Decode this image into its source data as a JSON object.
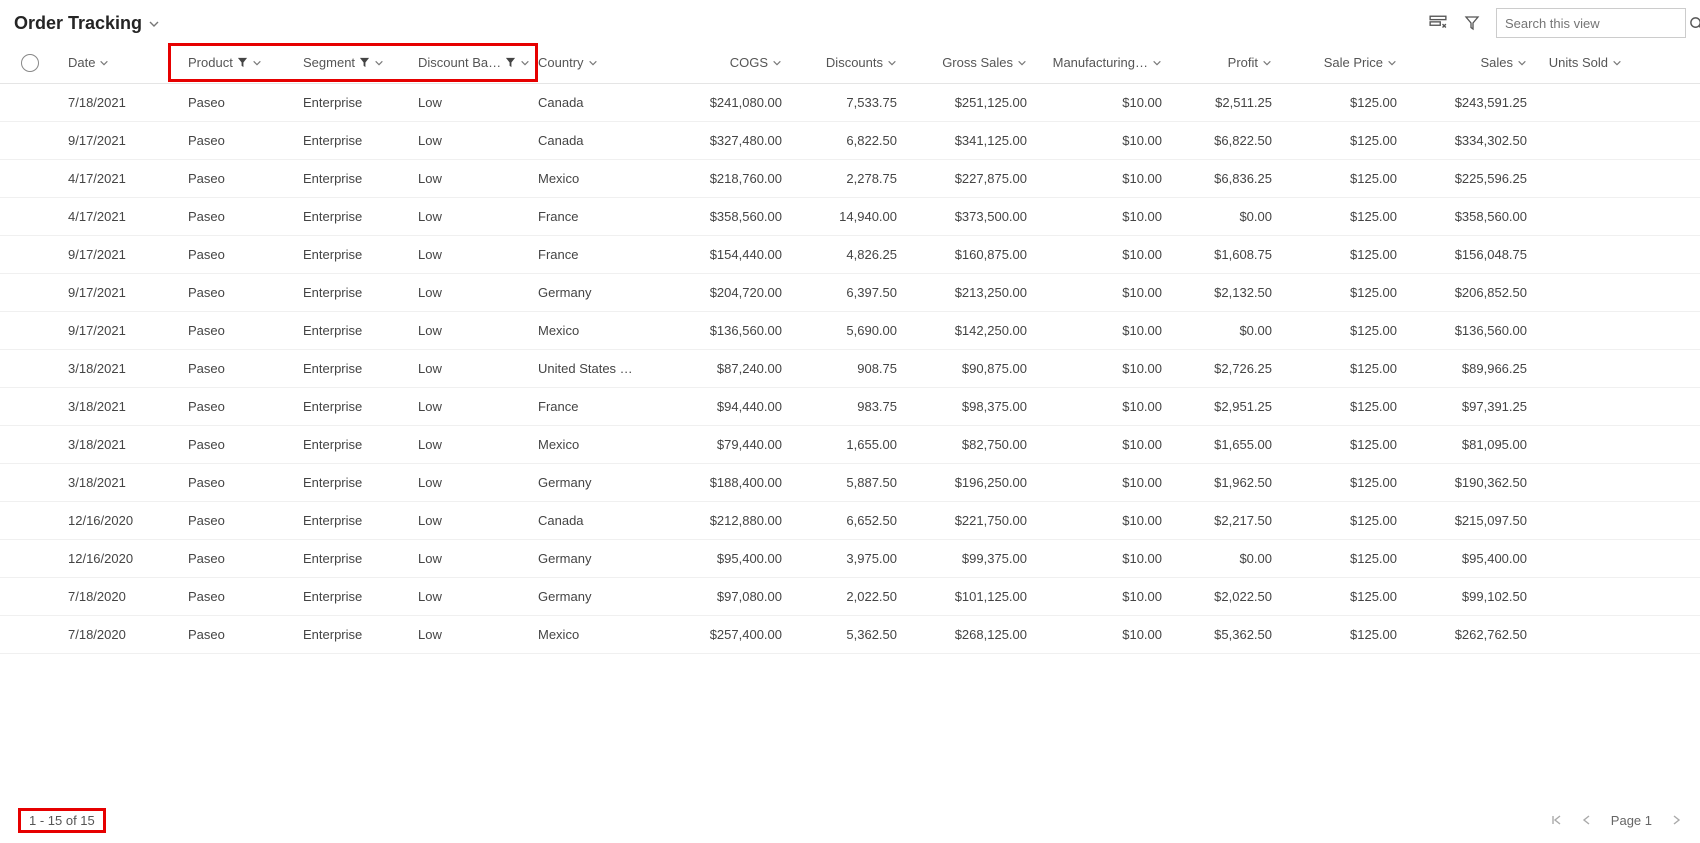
{
  "view": {
    "title": "Order Tracking"
  },
  "toolbar": {
    "search_placeholder": "Search this view"
  },
  "columns": {
    "date": "Date",
    "product": "Product",
    "segment": "Segment",
    "discount_band": "Discount Ba…",
    "country": "Country",
    "cogs": "COGS",
    "discounts": "Discounts",
    "gross_sales": "Gross Sales",
    "manufacturing": "Manufacturing…",
    "profit": "Profit",
    "sale_price": "Sale Price",
    "sales": "Sales",
    "units_sold": "Units Sold"
  },
  "rows": [
    {
      "date": "7/18/2021",
      "product": "Paseo",
      "segment": "Enterprise",
      "discount_band": "Low",
      "country": "Canada",
      "cogs": "$241,080.00",
      "discounts": "7,533.75",
      "gross_sales": "$251,125.00",
      "manufacturing": "$10.00",
      "profit": "$2,511.25",
      "sale_price": "$125.00",
      "sales": "$243,591.25"
    },
    {
      "date": "9/17/2021",
      "product": "Paseo",
      "segment": "Enterprise",
      "discount_band": "Low",
      "country": "Canada",
      "cogs": "$327,480.00",
      "discounts": "6,822.50",
      "gross_sales": "$341,125.00",
      "manufacturing": "$10.00",
      "profit": "$6,822.50",
      "sale_price": "$125.00",
      "sales": "$334,302.50"
    },
    {
      "date": "4/17/2021",
      "product": "Paseo",
      "segment": "Enterprise",
      "discount_band": "Low",
      "country": "Mexico",
      "cogs": "$218,760.00",
      "discounts": "2,278.75",
      "gross_sales": "$227,875.00",
      "manufacturing": "$10.00",
      "profit": "$6,836.25",
      "sale_price": "$125.00",
      "sales": "$225,596.25"
    },
    {
      "date": "4/17/2021",
      "product": "Paseo",
      "segment": "Enterprise",
      "discount_band": "Low",
      "country": "France",
      "cogs": "$358,560.00",
      "discounts": "14,940.00",
      "gross_sales": "$373,500.00",
      "manufacturing": "$10.00",
      "profit": "$0.00",
      "sale_price": "$125.00",
      "sales": "$358,560.00"
    },
    {
      "date": "9/17/2021",
      "product": "Paseo",
      "segment": "Enterprise",
      "discount_band": "Low",
      "country": "France",
      "cogs": "$154,440.00",
      "discounts": "4,826.25",
      "gross_sales": "$160,875.00",
      "manufacturing": "$10.00",
      "profit": "$1,608.75",
      "sale_price": "$125.00",
      "sales": "$156,048.75"
    },
    {
      "date": "9/17/2021",
      "product": "Paseo",
      "segment": "Enterprise",
      "discount_band": "Low",
      "country": "Germany",
      "cogs": "$204,720.00",
      "discounts": "6,397.50",
      "gross_sales": "$213,250.00",
      "manufacturing": "$10.00",
      "profit": "$2,132.50",
      "sale_price": "$125.00",
      "sales": "$206,852.50"
    },
    {
      "date": "9/17/2021",
      "product": "Paseo",
      "segment": "Enterprise",
      "discount_band": "Low",
      "country": "Mexico",
      "cogs": "$136,560.00",
      "discounts": "5,690.00",
      "gross_sales": "$142,250.00",
      "manufacturing": "$10.00",
      "profit": "$0.00",
      "sale_price": "$125.00",
      "sales": "$136,560.00"
    },
    {
      "date": "3/18/2021",
      "product": "Paseo",
      "segment": "Enterprise",
      "discount_band": "Low",
      "country": "United States …",
      "cogs": "$87,240.00",
      "discounts": "908.75",
      "gross_sales": "$90,875.00",
      "manufacturing": "$10.00",
      "profit": "$2,726.25",
      "sale_price": "$125.00",
      "sales": "$89,966.25"
    },
    {
      "date": "3/18/2021",
      "product": "Paseo",
      "segment": "Enterprise",
      "discount_band": "Low",
      "country": "France",
      "cogs": "$94,440.00",
      "discounts": "983.75",
      "gross_sales": "$98,375.00",
      "manufacturing": "$10.00",
      "profit": "$2,951.25",
      "sale_price": "$125.00",
      "sales": "$97,391.25"
    },
    {
      "date": "3/18/2021",
      "product": "Paseo",
      "segment": "Enterprise",
      "discount_band": "Low",
      "country": "Mexico",
      "cogs": "$79,440.00",
      "discounts": "1,655.00",
      "gross_sales": "$82,750.00",
      "manufacturing": "$10.00",
      "profit": "$1,655.00",
      "sale_price": "$125.00",
      "sales": "$81,095.00"
    },
    {
      "date": "3/18/2021",
      "product": "Paseo",
      "segment": "Enterprise",
      "discount_band": "Low",
      "country": "Germany",
      "cogs": "$188,400.00",
      "discounts": "5,887.50",
      "gross_sales": "$196,250.00",
      "manufacturing": "$10.00",
      "profit": "$1,962.50",
      "sale_price": "$125.00",
      "sales": "$190,362.50"
    },
    {
      "date": "12/16/2020",
      "product": "Paseo",
      "segment": "Enterprise",
      "discount_band": "Low",
      "country": "Canada",
      "cogs": "$212,880.00",
      "discounts": "6,652.50",
      "gross_sales": "$221,750.00",
      "manufacturing": "$10.00",
      "profit": "$2,217.50",
      "sale_price": "$125.00",
      "sales": "$215,097.50"
    },
    {
      "date": "12/16/2020",
      "product": "Paseo",
      "segment": "Enterprise",
      "discount_band": "Low",
      "country": "Germany",
      "cogs": "$95,400.00",
      "discounts": "3,975.00",
      "gross_sales": "$99,375.00",
      "manufacturing": "$10.00",
      "profit": "$0.00",
      "sale_price": "$125.00",
      "sales": "$95,400.00"
    },
    {
      "date": "7/18/2020",
      "product": "Paseo",
      "segment": "Enterprise",
      "discount_band": "Low",
      "country": "Germany",
      "cogs": "$97,080.00",
      "discounts": "2,022.50",
      "gross_sales": "$101,125.00",
      "manufacturing": "$10.00",
      "profit": "$2,022.50",
      "sale_price": "$125.00",
      "sales": "$99,102.50"
    },
    {
      "date": "7/18/2020",
      "product": "Paseo",
      "segment": "Enterprise",
      "discount_band": "Low",
      "country": "Mexico",
      "cogs": "$257,400.00",
      "discounts": "5,362.50",
      "gross_sales": "$268,125.00",
      "manufacturing": "$10.00",
      "profit": "$5,362.50",
      "sale_price": "$125.00",
      "sales": "$262,762.50"
    }
  ],
  "footer": {
    "count_text": "1 - 15 of 15",
    "page_label": "Page 1"
  }
}
